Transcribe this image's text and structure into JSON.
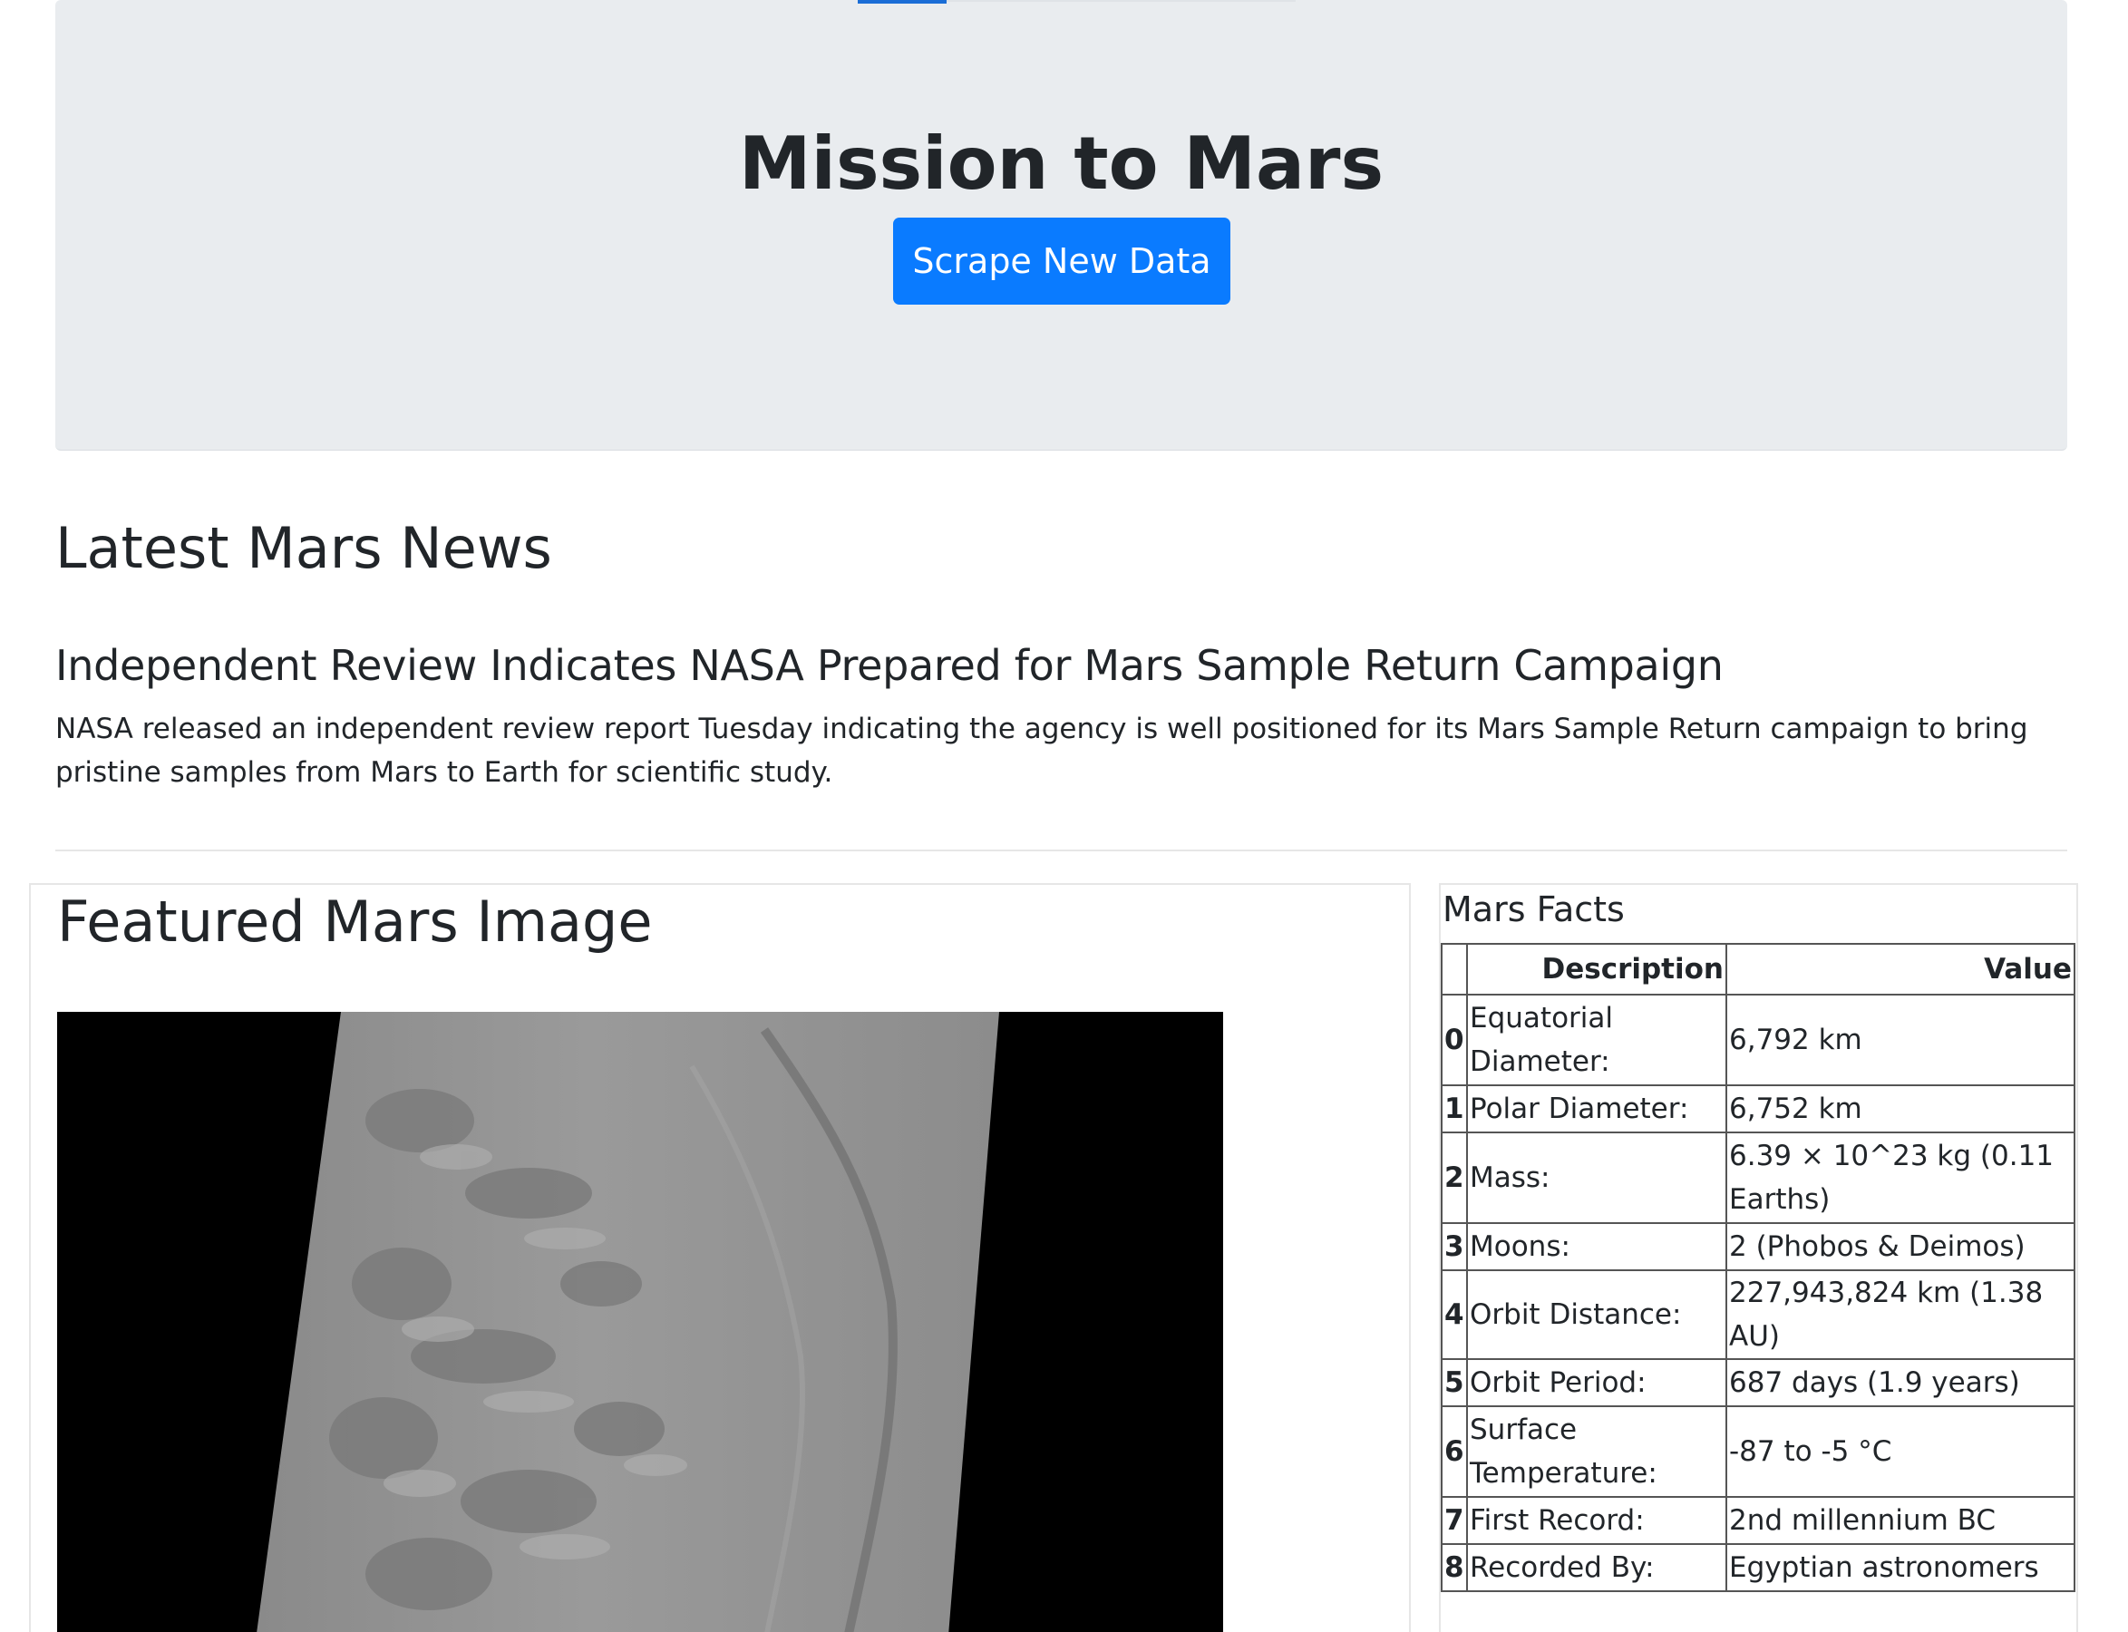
{
  "hero": {
    "title": "Mission to Mars",
    "scrape_label": "Scrape New Data"
  },
  "news": {
    "heading": "Latest Mars News",
    "title": "Independent Review Indicates NASA Prepared for Mars Sample Return Campaign",
    "teaser": "NASA released an independent review report Tuesday indicating the agency is well positioned for its Mars Sample Return campaign to bring pristine samples from Mars to Earth for scientific study."
  },
  "featured": {
    "heading": "Featured Mars Image"
  },
  "facts": {
    "heading": "Mars Facts",
    "columns": [
      "",
      "Description",
      "Value"
    ],
    "rows": [
      {
        "index": "0",
        "description": "Equatorial Diameter:",
        "value": "6,792 km"
      },
      {
        "index": "1",
        "description": "Polar Diameter:",
        "value": "6,752 km"
      },
      {
        "index": "2",
        "description": "Mass:",
        "value": "6.39 × 10^23 kg (0.11 Earths)"
      },
      {
        "index": "3",
        "description": "Moons:",
        "value": "2 (Phobos & Deimos)"
      },
      {
        "index": "4",
        "description": "Orbit Distance:",
        "value": "227,943,824 km (1.38 AU)"
      },
      {
        "index": "5",
        "description": "Orbit Period:",
        "value": "687 days (1.9 years)"
      },
      {
        "index": "6",
        "description": "Surface Temperature:",
        "value": "-87 to -5 °C"
      },
      {
        "index": "7",
        "description": "First Record:",
        "value": "2nd millennium BC"
      },
      {
        "index": "8",
        "description": "Recorded By:",
        "value": "Egyptian astronomers"
      }
    ]
  },
  "colors": {
    "primary_button": "#0a7bff",
    "jumbotron_bg": "#e9ecef",
    "text": "#212529"
  }
}
